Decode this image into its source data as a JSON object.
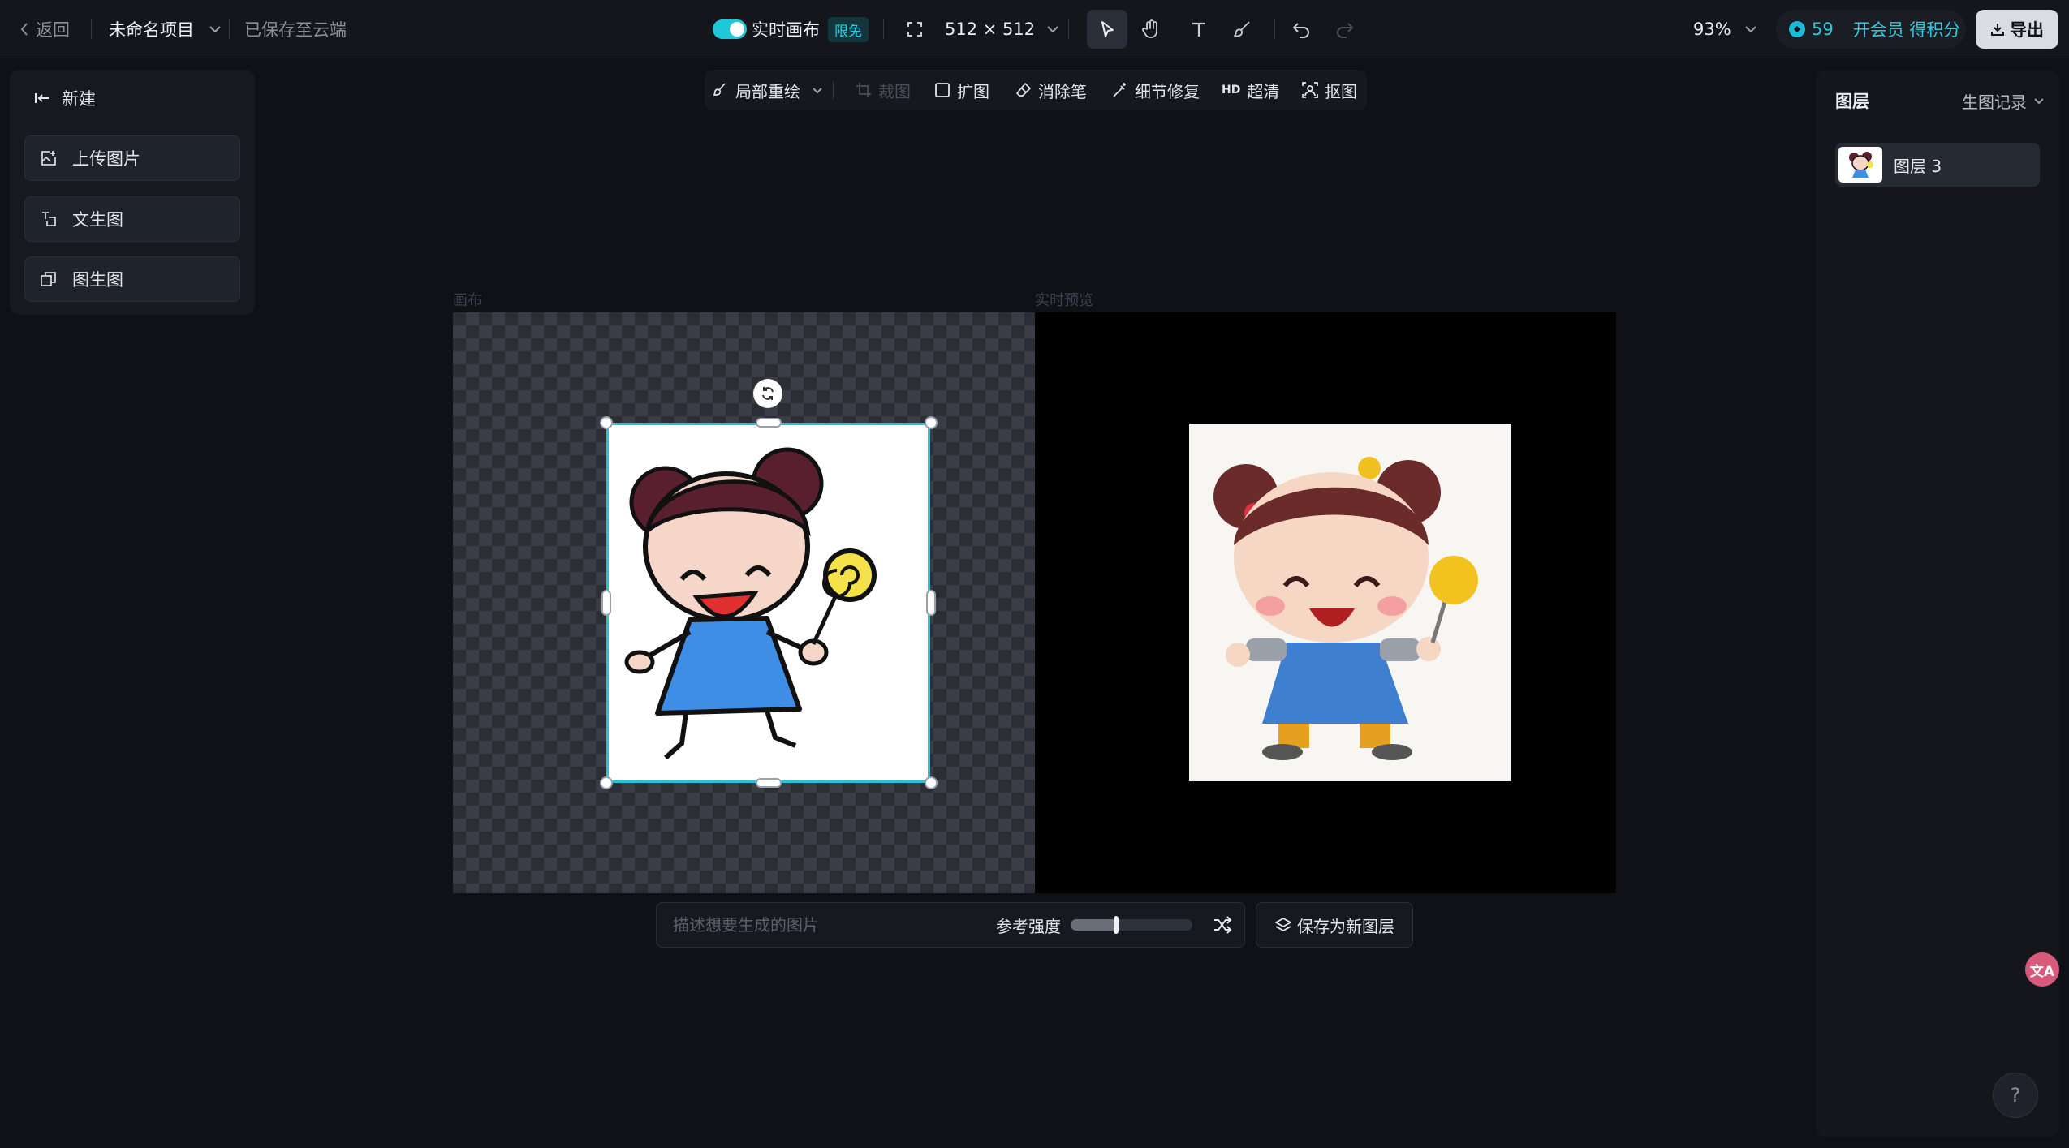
{
  "topbar": {
    "back_label": "返回",
    "project_name": "未命名项目",
    "save_status": "已保存至云端",
    "realtime_canvas_label": "实时画布",
    "limited_badge": "限免",
    "canvas_size": "512 × 512",
    "zoom": "93%",
    "credits": "59",
    "vip_label": "开会员 得积分",
    "export_label": "导出"
  },
  "left_panel": {
    "header": "新建",
    "buttons": [
      "上传图片",
      "文生图",
      "图生图"
    ]
  },
  "subbar": {
    "inpaint": "局部重绘",
    "crop": "裁图",
    "expand": "扩图",
    "eraser": "消除笔",
    "detail_repair": "细节修复",
    "hd_prefix": "HD",
    "upscale": "超清",
    "matting": "抠图"
  },
  "canvas": {
    "left_caption": "画布",
    "right_caption": "实时预览"
  },
  "prompt_bar": {
    "placeholder": "描述想要生成的图片",
    "value": "",
    "strength_label": "参考强度",
    "strength_value": 0.37,
    "save_as_layer": "保存为新图层"
  },
  "right_panel": {
    "title": "图层",
    "history_label": "生图记录",
    "layers": [
      {
        "name": "图层 3"
      }
    ]
  },
  "floating": {
    "translate_label": "文A",
    "help_label": "?"
  },
  "colors": {
    "accent": "#22c4d6",
    "background": "#0f1116",
    "panel": "#16191f",
    "export_button": "#d9dce2"
  },
  "icons": [
    "chevron-left-icon",
    "chevron-down-icon",
    "resize-icon",
    "pointer-icon",
    "hand-icon",
    "text-icon",
    "brush-icon",
    "undo-icon",
    "redo-icon",
    "coin-icon",
    "download-icon",
    "arrow-left-icon",
    "upload-image-icon",
    "text-to-image-icon",
    "image-to-image-icon",
    "inpaint-icon",
    "crop-icon",
    "expand-icon",
    "eraser-icon",
    "wand-icon",
    "matting-icon",
    "rotate-icon",
    "shuffle-icon",
    "layers-icon",
    "translate-icon",
    "help-icon"
  ]
}
